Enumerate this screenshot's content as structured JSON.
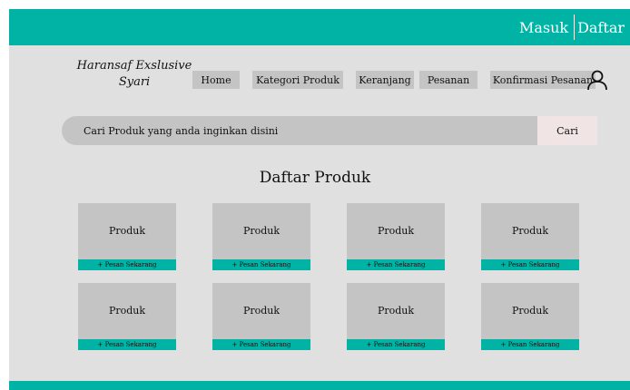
{
  "header": {
    "login_label": "Masuk",
    "register_label": "Daftar"
  },
  "logo": {
    "line1": "Haransaf Exslusive",
    "line2": "Syari"
  },
  "nav": {
    "items": [
      {
        "label": "Home"
      },
      {
        "label": "Kategori Produk"
      },
      {
        "label": "Keranjang"
      },
      {
        "label": "Pesanan"
      },
      {
        "label": "Konfirmasi Pesanan"
      }
    ],
    "user_icon": "user-icon"
  },
  "search": {
    "placeholder": "Cari Produk yang anda inginkan disini",
    "button_label": "Cari"
  },
  "products": {
    "title": "Daftar Produk",
    "items": [
      {
        "name": "Produk",
        "cta": "+ Pesan Sekarang"
      },
      {
        "name": "Produk",
        "cta": "+ Pesan Sekarang"
      },
      {
        "name": "Produk",
        "cta": "+ Pesan Sekarang"
      },
      {
        "name": "Produk",
        "cta": "+ Pesan Sekarang"
      },
      {
        "name": "Produk",
        "cta": "+ Pesan Sekarang"
      },
      {
        "name": "Produk",
        "cta": "+ Pesan Sekarang"
      },
      {
        "name": "Produk",
        "cta": "+ Pesan Sekarang"
      },
      {
        "name": "Produk",
        "cta": "+ Pesan Sekarang"
      }
    ]
  },
  "colors": {
    "accent": "#00b3a4",
    "panel": "#e0e0e0",
    "block": "#c4c4c4",
    "search_button": "#f0e4e4"
  }
}
